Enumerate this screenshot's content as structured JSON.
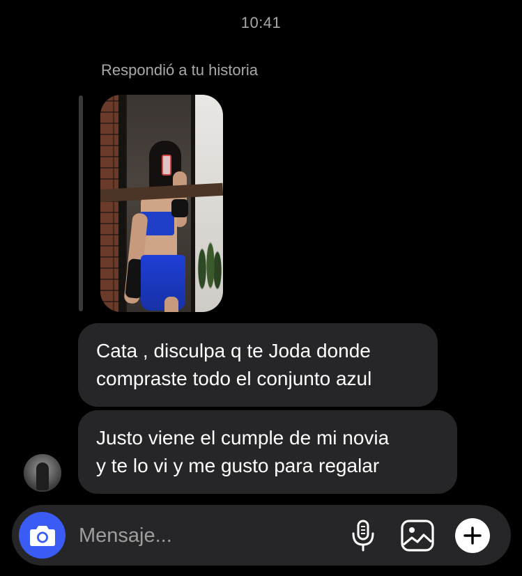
{
  "header": {
    "time": "10:41"
  },
  "story_reply": {
    "label": "Respondió a tu historia"
  },
  "messages": [
    {
      "lines": [
        "Cata , disculpa q te Joda donde",
        "compraste todo el conjunto azul"
      ]
    },
    {
      "lines": [
        "Justo viene el cumple de mi novia",
        "y te lo vi y me gusto para regalar"
      ]
    }
  ],
  "composer": {
    "placeholder": "Mensaje...",
    "value": "",
    "icons": {
      "camera": "camera-icon",
      "mic": "microphone-icon",
      "gallery": "image-gallery-icon",
      "plus": "plus-icon"
    },
    "accent_color": "#3b5bf5"
  },
  "theme": {
    "background": "#000000",
    "bubble": "#262628",
    "muted_text": "#a8a8a8"
  }
}
